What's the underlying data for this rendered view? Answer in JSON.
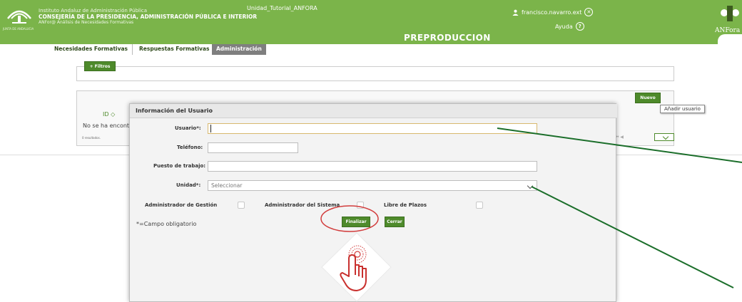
{
  "header": {
    "institute": "Instituto Andaluz de Administración Pública",
    "consejeria": "CONSEJERÍA DE LA PRESIDENCIA, ADMINISTRACIÓN PÚBLICA E INTERIOR",
    "app_subtitle": "ANFor@ Análisis de Necesidades Formativas",
    "unit": "Unidad_Tutorial_ANFORA",
    "username": "francisco.navarro.ext",
    "help": "Ayuda",
    "environment": "PREPRODUCCION",
    "brand_right": "ANFora",
    "logo_caption": "JUNTA DE ANDALUCIA",
    "close_glyph": "✕",
    "help_glyph": "?"
  },
  "tabs": [
    {
      "label": "Necesidades Formativas"
    },
    {
      "label": "Respuestas Formativas"
    },
    {
      "label": "Administración"
    }
  ],
  "filters": {
    "button_label": "+ Filtros"
  },
  "results": {
    "new_button": "Nuevo",
    "new_tooltip": "Añadir usuario",
    "id_column": "ID ◇",
    "no_results_text": "No se ha encontr",
    "results_count": "0 resultados.",
    "pager_glyphs": "⏮ ◀"
  },
  "modal": {
    "title": "Información del Usuario",
    "fields": {
      "usuario_label": "Usuario*:",
      "telefono_label": "Teléfono:",
      "puesto_label": "Puesto de trabajo:",
      "unidad_label": "Unidad*:",
      "unidad_value": "Seleccionar"
    },
    "checkboxes": [
      {
        "label": "Administrador de Gestión",
        "checked": false
      },
      {
        "label": "Administrador del Sistema",
        "checked": false
      },
      {
        "label": "Libre de Plazos",
        "checked": false
      }
    ],
    "required_note": "*=Campo obligatorio",
    "finalizar_label": "Finalizar",
    "cerrar_label": "Cerrar"
  },
  "colors": {
    "header_green": "#7bb44a",
    "button_green": "#4e8a2b",
    "annotation_line": "#1b6e2a",
    "highlight_circle": "#d23c3c"
  },
  "annotations": {
    "hand_cursor_icon": "hand-pointer-icon"
  }
}
